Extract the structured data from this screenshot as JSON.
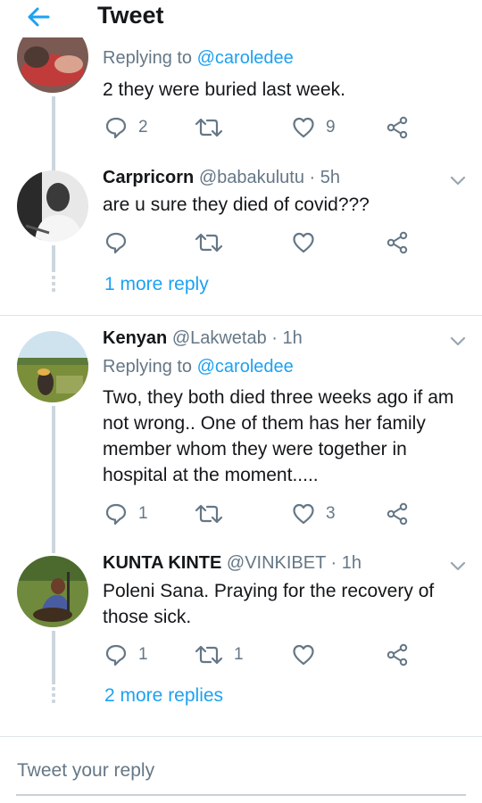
{
  "header": {
    "title": "Tweet",
    "back_icon": "arrow-left-icon",
    "accent": "#1da1f2"
  },
  "tweets": [
    {
      "replying_prefix": "Replying to",
      "replying_handle": "@caroledee",
      "text": "2 they were buried last week.",
      "reply_count": "2",
      "retweet_count": "",
      "like_count": "9"
    },
    {
      "name": "Carpricorn",
      "handle": "@babakulutu",
      "time": "· 5h",
      "text": "are u sure they died of covid???",
      "reply_count": "",
      "retweet_count": "",
      "like_count": "",
      "more": "1 more reply"
    },
    {
      "name": "Kenyan",
      "handle": "@Lakwetab",
      "time": "· 1h",
      "replying_prefix": "Replying to",
      "replying_handle": "@caroledee",
      "text": "Two, they both  died three weeks ago if am not wrong.. One of them has her family member whom they were together in hospital at the moment.....",
      "reply_count": "1",
      "retweet_count": "",
      "like_count": "3"
    },
    {
      "name": "KUNTA KINTE",
      "handle": "@VINKIBET",
      "time": "· 1h",
      "text": "Poleni Sana. Praying for the recovery of those sick.",
      "reply_count": "1",
      "retweet_count": "1",
      "like_count": "",
      "more": "2 more replies"
    }
  ],
  "reply_box": {
    "placeholder": "Tweet your reply"
  }
}
